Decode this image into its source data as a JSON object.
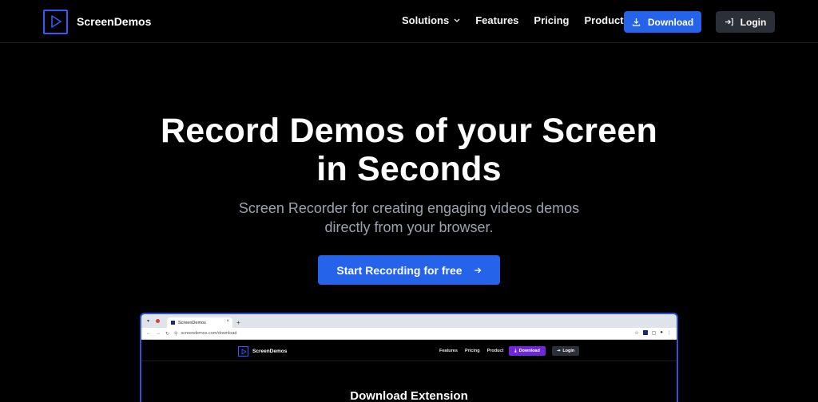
{
  "brand": {
    "name": "ScreenDemos",
    "accent": "#2563eb"
  },
  "nav": {
    "links": [
      "Solutions",
      "Features",
      "Pricing",
      "Product"
    ],
    "download_label": "Download",
    "login_label": "Login"
  },
  "hero": {
    "title_line1": "Record Demos of your Screen",
    "title_line2": "in Seconds",
    "subtitle_line1": "Screen Recorder for creating engaging videos demos",
    "subtitle_line2": "directly from your browser.",
    "cta_label": "Start Recording for free"
  },
  "preview": {
    "tab_title": "ScreenDemos",
    "url": "screendemos.com/download",
    "brand_name": "ScreenDemos",
    "links": [
      "Features",
      "Pricing",
      "Product"
    ],
    "download_label": "Download",
    "login_label": "Login",
    "heading": "Download Extension"
  },
  "icons": {
    "logo": "play-icon",
    "solutions_caret": "chevron-down-icon",
    "download": "download-icon",
    "login": "login-icon",
    "cta": "arrow-right-icon"
  }
}
